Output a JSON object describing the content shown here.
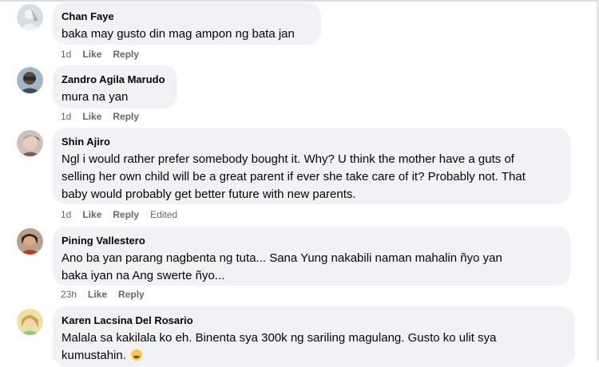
{
  "comments": [
    {
      "name": "Chan Faye",
      "lines": [
        "baka may gusto din mag ampon ng bata jan"
      ],
      "time": "1d",
      "like": "Like",
      "reply": "Reply",
      "edited": ""
    },
    {
      "name": "Zandro Agila Marudo",
      "lines": [
        "mura na yan"
      ],
      "time": "1d",
      "like": "Like",
      "reply": "Reply",
      "edited": ""
    },
    {
      "name": "Shin Ajiro",
      "lines": [
        "Ngl i would rather prefer somebody bought it. Why? U think the mother have a guts of",
        "selling her own child will be a great parent if ever she take care of it? Probably not. That",
        "baby would probably get better future with new parents."
      ],
      "time": "1d",
      "like": "Like",
      "reply": "Reply",
      "edited": "Edited"
    },
    {
      "name": "Pining Vallestero",
      "lines": [
        "Ano ba yan parang nagbenta ng tuta... Sana Yung nakabili naman mahalin ñyo yan",
        "baka iyan na Ang swerte ñyo..."
      ],
      "time": "23h",
      "like": "Like",
      "reply": "Reply",
      "edited": ""
    },
    {
      "name": "Karen Lacsina Del Rosario",
      "lines": [
        "Malala sa kakilala ko eh. Binenta sya 300k ng sariling magulang. Gusto ko ulit sya",
        "kumustahin."
      ],
      "emoji": "sweat-smile-emoji",
      "time": "",
      "like": "",
      "reply": "",
      "edited": ""
    }
  ]
}
